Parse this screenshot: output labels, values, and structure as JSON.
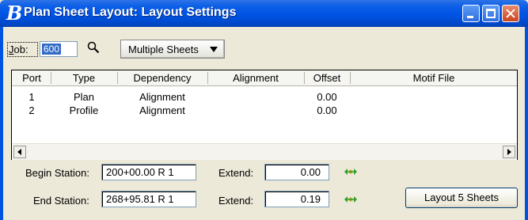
{
  "window": {
    "title": "Plan Sheet Layout: Layout Settings"
  },
  "job": {
    "label_prefix": "J",
    "label_rest": "ob:",
    "value": "600"
  },
  "sheet_mode": {
    "selected": "Multiple Sheets"
  },
  "table": {
    "headers": [
      "Port",
      "Type",
      "Dependency",
      "Alignment",
      "Offset",
      "Motif File"
    ],
    "rows": [
      [
        "1",
        "Plan",
        "Alignment",
        "",
        "0.00",
        ""
      ],
      [
        "2",
        "Profile",
        "Alignment",
        "",
        "0.00",
        ""
      ]
    ]
  },
  "begin": {
    "label": "Begin Station:",
    "station": "200+00.00 R 1",
    "extend_label": "Extend:",
    "extend_value": "0.00"
  },
  "end": {
    "label": "End Station:",
    "station": "268+95.81 R 1",
    "extend_label": "Extend:",
    "extend_value": "0.19"
  },
  "layout_button": {
    "label": "Layout 5 Sheets"
  },
  "colors": {
    "title_bar": "#0054e3",
    "dialog_bg": "#ece9d8",
    "move_icon": "#2ca02c"
  }
}
